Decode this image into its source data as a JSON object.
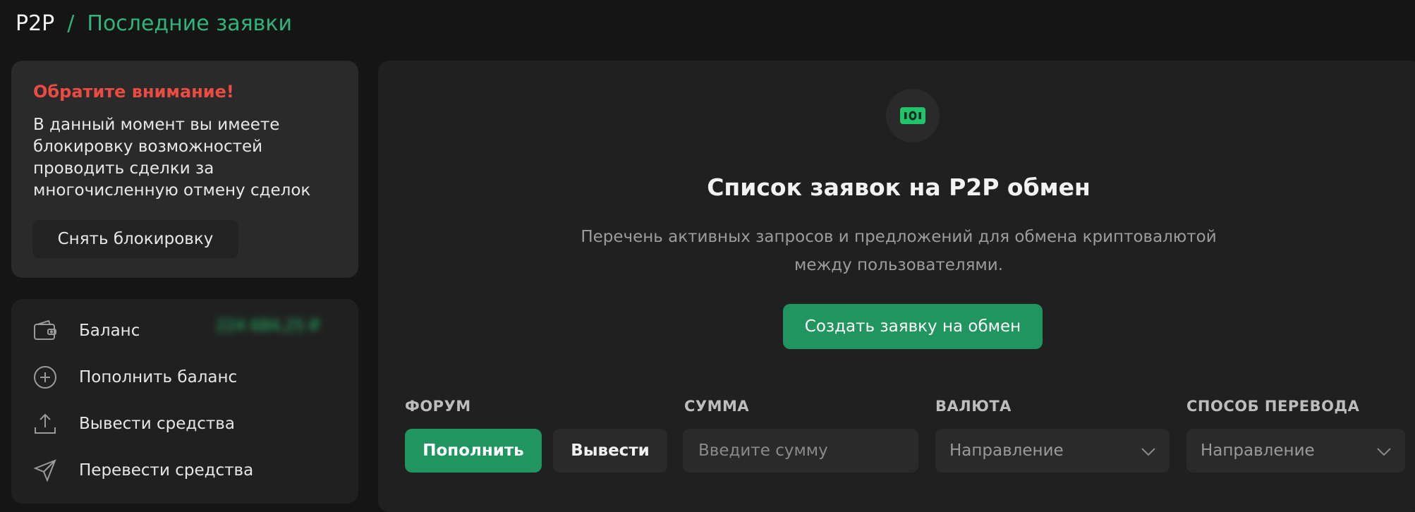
{
  "breadcrumb": {
    "root": "P2P",
    "separator": "/",
    "current": "Последние заявки"
  },
  "alert": {
    "title": "Обратите внимание!",
    "text": "В данный момент вы имеете\nблокировку возможностей\nпроводить сделки за\nмногочисленную отмену сделок",
    "button": "Снять блокировку"
  },
  "menu": {
    "balance_label": "Баланс",
    "balance_value": "224 684,25 ₽",
    "deposit": "Пополнить баланс",
    "withdraw": "Вывести средства",
    "transfer": "Перевести средства"
  },
  "main": {
    "title": "Список заявок на P2P обмен",
    "description": "Перечень активных запросов и предложений для обмена криптовалютой между пользователями.",
    "create_button": "Создать заявку на обмен"
  },
  "filters": {
    "forum_label": "ФОРУМ",
    "deposit_button": "Пополнить",
    "withdraw_button": "Вывести",
    "amount_label": "СУММА",
    "amount_placeholder": "Введите сумму",
    "currency_label": "ВАЛЮТА",
    "currency_value": "Направление",
    "method_label": "СПОСОБ ПЕРЕВОДА",
    "method_value": "Направление"
  },
  "colors": {
    "accent": "#21955f",
    "warning": "#ea4b43",
    "background": "#151515",
    "card": "#202020"
  }
}
